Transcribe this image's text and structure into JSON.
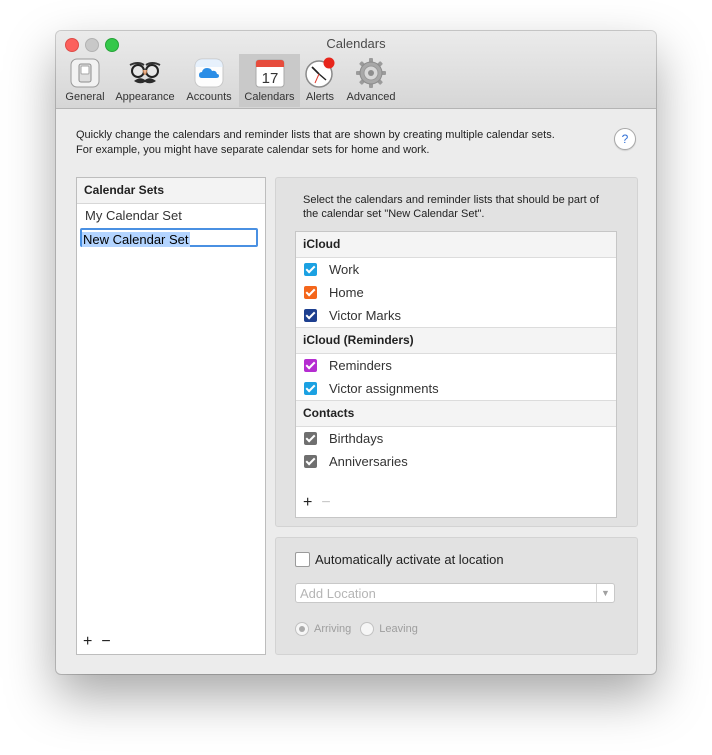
{
  "window": {
    "title": "Calendars"
  },
  "toolbar": {
    "tabs": [
      {
        "label": "General",
        "icon": "switch-icon"
      },
      {
        "label": "Appearance",
        "icon": "disguise-mask-icon"
      },
      {
        "label": "Accounts",
        "icon": "icloud-icon"
      },
      {
        "label": "Calendars",
        "icon": "calendar-icon",
        "selected": true,
        "day": "17"
      },
      {
        "label": "Alerts",
        "icon": "clock-alert-icon"
      },
      {
        "label": "Advanced",
        "icon": "gear-icon"
      }
    ]
  },
  "intro": {
    "line1": "Quickly change the calendars and reminder lists that are shown by creating multiple calendar sets.",
    "line2": "For example, you might have separate calendar sets for home and work."
  },
  "help": {
    "label": "?"
  },
  "calendar_sets": {
    "header": "Calendar Sets",
    "items": [
      {
        "label": "My Calendar Set"
      },
      {
        "label": "New Calendar Set",
        "editing": true
      }
    ],
    "add_label": "+",
    "remove_label": "−"
  },
  "calendars": {
    "instructions": "Select the calendars and reminder lists that should be part of the calendar set \"New Calendar Set\".",
    "groups": [
      {
        "name": "iCloud",
        "items": [
          {
            "label": "Work",
            "color": "#1ba1e2",
            "checked": true
          },
          {
            "label": "Home",
            "color": "#f4661b",
            "checked": true
          },
          {
            "label": "Victor Marks",
            "color": "#1d3f8f",
            "checked": true
          }
        ]
      },
      {
        "name": "iCloud (Reminders)",
        "items": [
          {
            "label": "Reminders",
            "color": "#b52dd1",
            "checked": true
          },
          {
            "label": "Victor assignments",
            "color": "#1ba1e2",
            "checked": true
          }
        ]
      },
      {
        "name": "Contacts",
        "items": [
          {
            "label": "Birthdays",
            "color": "#6f6f6f",
            "checked": true
          },
          {
            "label": "Anniversaries",
            "color": "#6f6f6f",
            "checked": true
          }
        ]
      }
    ],
    "add_label": "+",
    "remove_label": "−"
  },
  "location": {
    "checkbox_label": "Automatically activate at location",
    "checked": false,
    "placeholder": "Add Location",
    "arriving_label": "Arriving",
    "leaving_label": "Leaving",
    "selected": "arriving"
  }
}
